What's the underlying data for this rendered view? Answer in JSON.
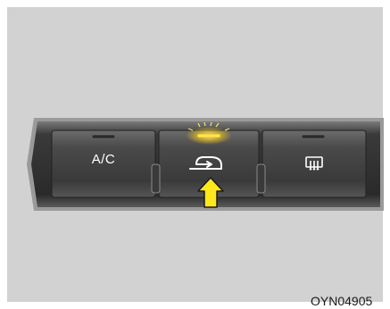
{
  "buttons": {
    "ac": {
      "label": "A/C",
      "icon": "ac-text"
    },
    "recirculation": {
      "icon": "air-recirculation-icon",
      "indicator_lit": true
    },
    "rear_defrost": {
      "icon": "rear-defroster-icon",
      "indicator_lit": false
    }
  },
  "pointer": {
    "icon": "up-arrow-icon",
    "color": "#ffe81a"
  },
  "indicator_glow_color": "#ffd21a",
  "caption": {
    "text": "OYN04905"
  }
}
